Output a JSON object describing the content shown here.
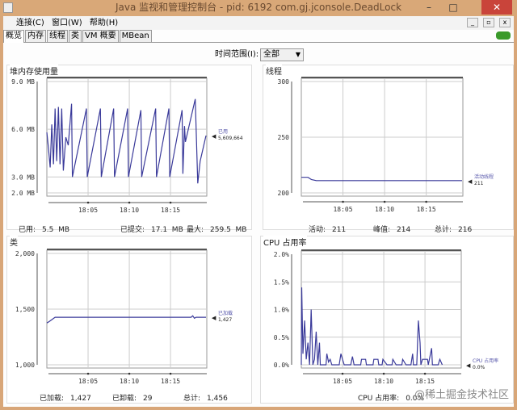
{
  "window": {
    "title": "Java 监视和管理控制台 - pid: 6192 com.gj.jconsole.DeadLock",
    "minimize": "–",
    "maximize": "□",
    "close": "✕"
  },
  "menu": [
    "连接(C)",
    "窗口(W)",
    "帮助(H)"
  ],
  "tabs": [
    "概览",
    "内存",
    "线程",
    "类",
    "VM 概要",
    "MBean"
  ],
  "time_range": {
    "label": "时间范围(I):",
    "value": "全部"
  },
  "watermark": "@稀土掘金技术社区",
  "chart_data": [
    {
      "id": "heap",
      "type": "line",
      "title": "堆内存使用量",
      "ylim": [
        2,
        9
      ],
      "yticks": [
        {
          "v": 9,
          "l": "9.0 MB"
        },
        {
          "v": 6,
          "l": "6.0 MB"
        },
        {
          "v": 3,
          "l": "3.0 MB"
        },
        {
          "v": 2,
          "l": "2.0 MB"
        }
      ],
      "xlabel_unit": "minutes since 18:00",
      "xticks": [
        {
          "v": 5,
          "l": "18:05"
        },
        {
          "v": 10,
          "l": "18:10"
        },
        {
          "v": 15,
          "l": "18:15"
        }
      ],
      "legend": {
        "name": "已用",
        "value": "5,609,664"
      },
      "points": [
        [
          0,
          5.8
        ],
        [
          0.2,
          4.8
        ],
        [
          0.4,
          3.6
        ],
        [
          0.6,
          6.3
        ],
        [
          0.8,
          3.8
        ],
        [
          1.0,
          7.3
        ],
        [
          1.2,
          4.0
        ],
        [
          1.4,
          7.4
        ],
        [
          1.6,
          3.8
        ],
        [
          1.8,
          7.3
        ],
        [
          2.0,
          3.4
        ],
        [
          2.3,
          5.5
        ],
        [
          2.6,
          5.0
        ],
        [
          3.0,
          7.6
        ],
        [
          3.1,
          3.0
        ],
        [
          4.8,
          7.3
        ],
        [
          4.9,
          3.0
        ],
        [
          6.5,
          7.3
        ],
        [
          6.6,
          3.0
        ],
        [
          8.1,
          7.3
        ],
        [
          8.2,
          3.0
        ],
        [
          9.8,
          7.3
        ],
        [
          9.9,
          3.0
        ],
        [
          11.4,
          7.2
        ],
        [
          11.5,
          3.0
        ],
        [
          13.2,
          7.3
        ],
        [
          13.3,
          3.0
        ],
        [
          14.8,
          7.3
        ],
        [
          14.9,
          3.0
        ],
        [
          16.4,
          7.2
        ],
        [
          16.5,
          3.2
        ],
        [
          16.7,
          6.2
        ],
        [
          16.8,
          5.2
        ],
        [
          18.0,
          7.9
        ],
        [
          18.3,
          2.6
        ],
        [
          18.6,
          4.0
        ],
        [
          19.3,
          5.6
        ]
      ],
      "footer": [
        {
          "label": "已用:",
          "value": "5.5  MB"
        },
        {
          "label": "已提交:",
          "value": "17.1  MB"
        },
        {
          "label": "最大:",
          "value": "259.5  MB"
        }
      ]
    },
    {
      "id": "threads",
      "type": "line",
      "title": "线程",
      "ylim": [
        200,
        300
      ],
      "yticks": [
        {
          "v": 300,
          "l": "300"
        },
        {
          "v": 250,
          "l": "250"
        },
        {
          "v": 200,
          "l": "200"
        }
      ],
      "xticks": [
        {
          "v": 5,
          "l": "18:05"
        },
        {
          "v": 10,
          "l": "18:10"
        },
        {
          "v": 15,
          "l": "18:15"
        }
      ],
      "legend": {
        "name": "活动线程",
        "value": "211"
      },
      "points": [
        [
          0,
          214
        ],
        [
          0.8,
          214
        ],
        [
          1.2,
          212
        ],
        [
          1.8,
          211
        ],
        [
          19.3,
          211
        ]
      ],
      "footer": [
        {
          "label": "活动:",
          "value": "211"
        },
        {
          "label": "峰值:",
          "value": "214"
        },
        {
          "label": "总计:",
          "value": "216"
        }
      ]
    },
    {
      "id": "classes",
      "type": "line",
      "title": "类",
      "ylim": [
        1000,
        2000
      ],
      "yticks": [
        {
          "v": 2000,
          "l": "2,000"
        },
        {
          "v": 1500,
          "l": "1,500"
        },
        {
          "v": 1000,
          "l": "1,000"
        }
      ],
      "xticks": [
        {
          "v": 5,
          "l": "18:05"
        },
        {
          "v": 10,
          "l": "18:10"
        },
        {
          "v": 15,
          "l": "18:15"
        }
      ],
      "legend": {
        "name": "已加载",
        "value": "1,427"
      },
      "points": [
        [
          0,
          1375
        ],
        [
          0.3,
          1390
        ],
        [
          1,
          1427
        ],
        [
          17.5,
          1427
        ],
        [
          17.7,
          1440
        ],
        [
          17.9,
          1418
        ],
        [
          18.1,
          1427
        ],
        [
          19.3,
          1427
        ]
      ],
      "footer": [
        {
          "label": "已加载:",
          "value": "1,427"
        },
        {
          "label": "已卸载:",
          "value": "29"
        },
        {
          "label": "总计:",
          "value": "1,456"
        }
      ]
    },
    {
      "id": "cpu",
      "type": "line",
      "title": "CPU 占用率",
      "ylim": [
        0,
        2
      ],
      "yticks": [
        {
          "v": 2,
          "l": "2.0%"
        },
        {
          "v": 1.5,
          "l": "1.5%"
        },
        {
          "v": 1,
          "l": "1.0%"
        },
        {
          "v": 0.5,
          "l": "0.5%"
        },
        {
          "v": 0,
          "l": "0.0%"
        }
      ],
      "xticks": [
        {
          "v": 5,
          "l": "18:05"
        },
        {
          "v": 10,
          "l": "18:10"
        },
        {
          "v": 15,
          "l": "18:15"
        }
      ],
      "legend": {
        "name": "CPU 占用率",
        "value": "0.0%"
      },
      "points": [
        [
          0,
          0
        ],
        [
          0.05,
          1.4
        ],
        [
          0.2,
          0.2
        ],
        [
          0.4,
          0.8
        ],
        [
          0.6,
          0.1
        ],
        [
          0.8,
          0.4
        ],
        [
          1.0,
          0
        ],
        [
          1.2,
          1.0
        ],
        [
          1.4,
          0
        ],
        [
          1.6,
          0.1
        ],
        [
          1.8,
          0.6
        ],
        [
          2.0,
          0
        ],
        [
          2.2,
          0.4
        ],
        [
          2.3,
          0
        ],
        [
          3.0,
          0
        ],
        [
          3.1,
          0.2
        ],
        [
          3.3,
          0.05
        ],
        [
          3.5,
          0.1
        ],
        [
          3.7,
          0
        ],
        [
          4.6,
          0
        ],
        [
          4.8,
          0.2
        ],
        [
          5.0,
          0.1
        ],
        [
          5.2,
          0
        ],
        [
          6.0,
          0
        ],
        [
          6.2,
          0.15
        ],
        [
          6.4,
          0
        ],
        [
          7.2,
          0
        ],
        [
          7.3,
          0.1
        ],
        [
          7.8,
          0.1
        ],
        [
          7.9,
          0
        ],
        [
          8.7,
          0
        ],
        [
          8.8,
          0.1
        ],
        [
          9.3,
          0.1
        ],
        [
          9.4,
          0
        ],
        [
          9.8,
          0
        ],
        [
          9.9,
          0.1
        ],
        [
          10.4,
          0
        ],
        [
          11.0,
          0
        ],
        [
          11.1,
          0.1
        ],
        [
          11.5,
          0
        ],
        [
          12.2,
          0
        ],
        [
          12.3,
          0.1
        ],
        [
          12.7,
          0
        ],
        [
          13.3,
          0
        ],
        [
          13.5,
          0.2
        ],
        [
          13.6,
          0
        ],
        [
          14.0,
          0
        ],
        [
          14.2,
          0.8
        ],
        [
          14.4,
          0.4
        ],
        [
          14.5,
          0
        ],
        [
          14.7,
          0.1
        ],
        [
          15.3,
          0.1
        ],
        [
          15.4,
          0
        ],
        [
          15.8,
          0.3
        ],
        [
          15.9,
          0
        ],
        [
          16.6,
          0
        ],
        [
          16.8,
          0.1
        ],
        [
          17.1,
          0
        ]
      ],
      "footer": [
        {
          "label": "CPU 占用率:",
          "value": "0.0%"
        }
      ]
    }
  ]
}
